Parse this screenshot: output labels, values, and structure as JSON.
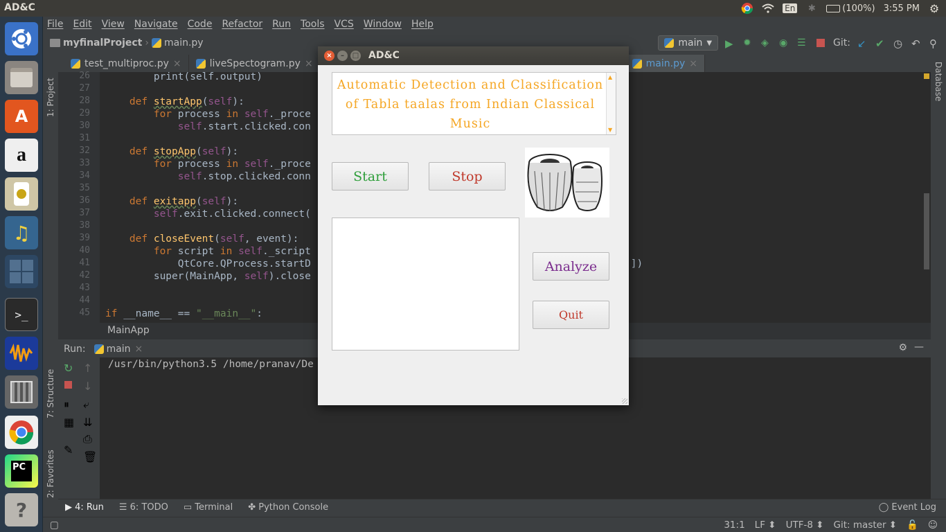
{
  "topbar": {
    "title": "AD&C",
    "keyboard": "En",
    "battery": "(100%)",
    "clock": "3:55 PM"
  },
  "launcher": {
    "icons": [
      "ubuntu-icon",
      "files-icon",
      "software-center-icon",
      "amazon-icon",
      "speaker-icon",
      "music-icon",
      "workspaces-icon",
      "terminal-icon",
      "audacity-icon",
      "archive-icon",
      "chrome-icon",
      "pycharm-icon",
      "help-icon"
    ]
  },
  "menubar": [
    "File",
    "Edit",
    "View",
    "Navigate",
    "Code",
    "Refactor",
    "Run",
    "Tools",
    "VCS",
    "Window",
    "Help"
  ],
  "navbar": {
    "project": "myfinalProject",
    "file": "main.py",
    "run_config": "main",
    "git_label": "Git:"
  },
  "tabs": [
    {
      "label": "test_multiproc.py",
      "active": false
    },
    {
      "label": "liveSpectogram.py",
      "active": false
    },
    {
      "label": "main.py",
      "active": true
    }
  ],
  "side_labels": {
    "project": "1: Project",
    "structure": "7: Structure",
    "favorites": "2: Favorites",
    "database": "Database"
  },
  "code": {
    "line_numbers": [
      "26",
      "27",
      "28",
      "29",
      "30",
      "31",
      "32",
      "33",
      "34",
      "35",
      "36",
      "37",
      "38",
      "39",
      "40",
      "41",
      "42",
      "43",
      "44",
      "45"
    ],
    "lines": [
      "        print(self.output)",
      "",
      "    def startApp(self):",
      "        for process in self._proce",
      "            self.start.clicked.con",
      "",
      "    def stopApp(self):",
      "        for process in self._proce",
      "            self.stop.clicked.conn",
      "",
      "    def exitapp(self):",
      "        self.exit.clicked.connect(",
      "",
      "    def closeEvent(self, event):",
      "        for script in self._script",
      "            QtCore.QProcess.startD",
      "        super(MainApp, self).close",
      "",
      "",
      "if __name__ == \"__main__\":"
    ],
    "overflow_text": ")])"
  },
  "breadcrumb": "MainApp",
  "run_panel": {
    "label": "Run:",
    "tab": "main",
    "console_line": "/usr/bin/python3.5 /home/pranav/De"
  },
  "bottom_tabs": [
    "4: Run",
    "6: TODO",
    "Terminal",
    "Python Console"
  ],
  "event_log": "Event Log",
  "status": {
    "position": "31:1",
    "line_sep": "LF",
    "encoding": "UTF-8",
    "git": "Git: master"
  },
  "dialog": {
    "title": "AD&C",
    "heading": "Automatic Detection and Classification of Tabla taalas from Indian Classical Music",
    "start_label": "Start",
    "stop_label": "Stop",
    "analyze_label": "Analyze",
    "quit_label": "Quit",
    "start_color": "#2e9e3a",
    "stop_color": "#c0392b",
    "analyze_color": "#7b2d8e",
    "quit_color": "#c0392b"
  }
}
